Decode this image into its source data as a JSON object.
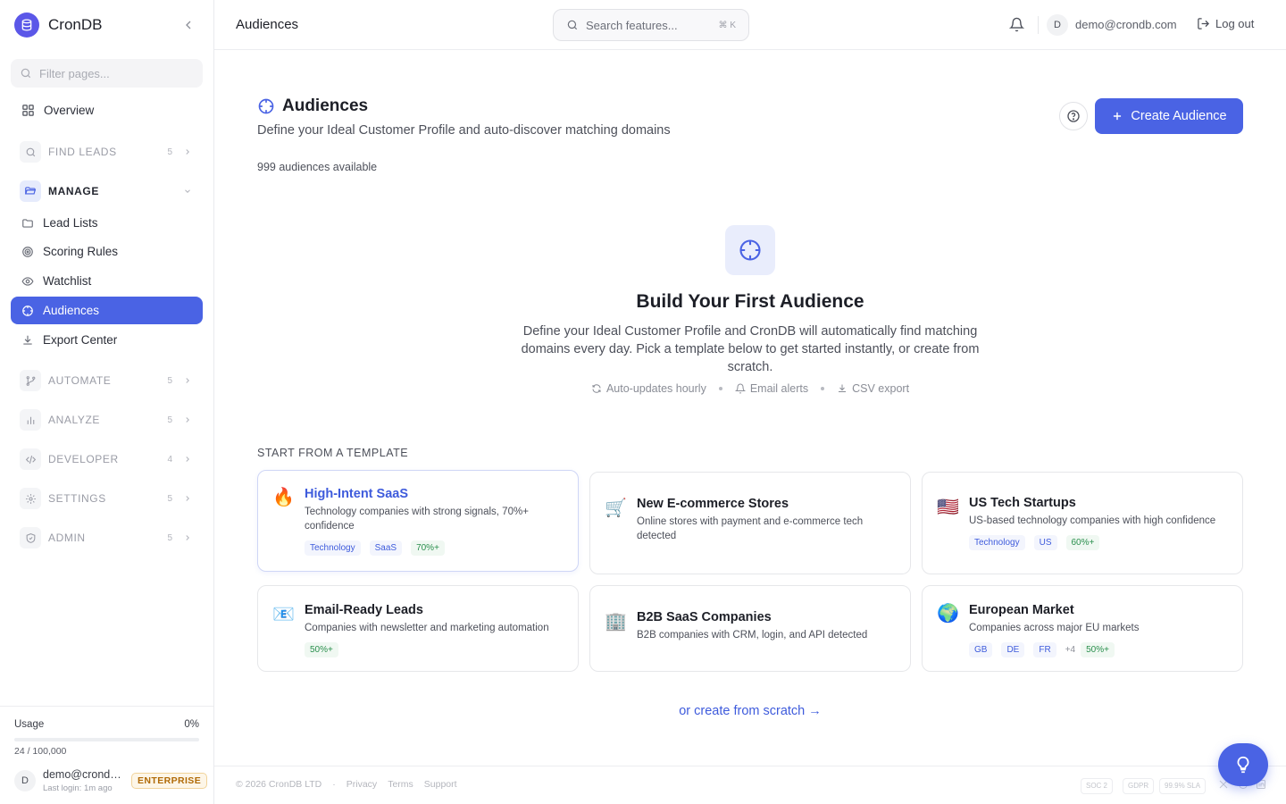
{
  "app": {
    "name": "CronDB"
  },
  "sidebar": {
    "filter_placeholder": "Filter pages...",
    "overview": "Overview",
    "groups": {
      "find_leads": {
        "label": "FIND LEADS",
        "count": "5"
      },
      "manage": {
        "label": "MANAGE"
      },
      "automate": {
        "label": "AUTOMATE",
        "count": "5"
      },
      "analyze": {
        "label": "ANALYZE",
        "count": "5"
      },
      "developer": {
        "label": "DEVELOPER",
        "count": "4"
      },
      "settings": {
        "label": "SETTINGS",
        "count": "5"
      },
      "admin": {
        "label": "ADMIN",
        "count": "5"
      }
    },
    "manage_items": [
      "Lead Lists",
      "Scoring Rules",
      "Watchlist",
      "Audiences",
      "Export Center"
    ],
    "usage": {
      "label": "Usage",
      "percent": "0%",
      "fraction": 0.0,
      "count": "24 / 100,000"
    },
    "user": {
      "initial": "D",
      "email": "demo@crondb.com",
      "last_login": "Last login: 1m ago",
      "plan": "ENTERPRISE"
    }
  },
  "topbar": {
    "page_title": "Audiences",
    "search_placeholder": "Search features...",
    "shortcut": "⌘ K",
    "user_initial": "D",
    "user_email": "demo@crondb.com",
    "logout": "Log out"
  },
  "main": {
    "title": "Audiences",
    "subtitle": "Define your Ideal Customer Profile and auto-discover matching domains",
    "available": "999 audiences available",
    "create_button": "Create Audience",
    "empty": {
      "title": "Build Your First Audience",
      "description": "Define your Ideal Customer Profile and CronDB will automatically find matching domains every day. Pick a template below to get started instantly, or create from scratch.",
      "features": [
        "Auto-updates hourly",
        "Email alerts",
        "CSV export"
      ]
    },
    "templates_label": "START FROM A TEMPLATE",
    "templates": [
      {
        "emoji": "🔥",
        "title": "High-Intent SaaS",
        "desc": "Technology companies with strong signals, 70%+ confidence",
        "tags": [
          "Technology",
          "SaaS"
        ],
        "score": "70%+"
      },
      {
        "emoji": "🛒",
        "title": "New E-commerce Stores",
        "desc": "Online stores with payment and e-commerce tech detected"
      },
      {
        "emoji": "🇺🇸",
        "title": "US Tech Startups",
        "desc": "US-based technology companies with high confidence",
        "tags": [
          "Technology",
          "US"
        ],
        "score": "60%+"
      },
      {
        "emoji": "📧",
        "title": "Email-Ready Leads",
        "desc": "Companies with newsletter and marketing automation",
        "score": "50%+"
      },
      {
        "emoji": "🏢",
        "title": "B2B SaaS Companies",
        "desc": "B2B companies with CRM, login, and API detected"
      },
      {
        "emoji": "🌍",
        "title": "European Market",
        "desc": "Companies across major EU markets",
        "tags": [
          "GB",
          "DE",
          "FR"
        ],
        "more": "+4",
        "score": "50%+"
      }
    ],
    "scratch_link": "or create from scratch →"
  },
  "footer": {
    "copyright": "© 2026 CronDB LTD",
    "links": [
      "Privacy",
      "Terms",
      "Support"
    ],
    "certs": [
      "SOC 2",
      "GDPR",
      "99.9% SLA"
    ]
  },
  "colors": {
    "accent": "#4a63e4",
    "brand": "#5b57e8",
    "badge": "#b06a06",
    "score": "#2a8f4d"
  }
}
